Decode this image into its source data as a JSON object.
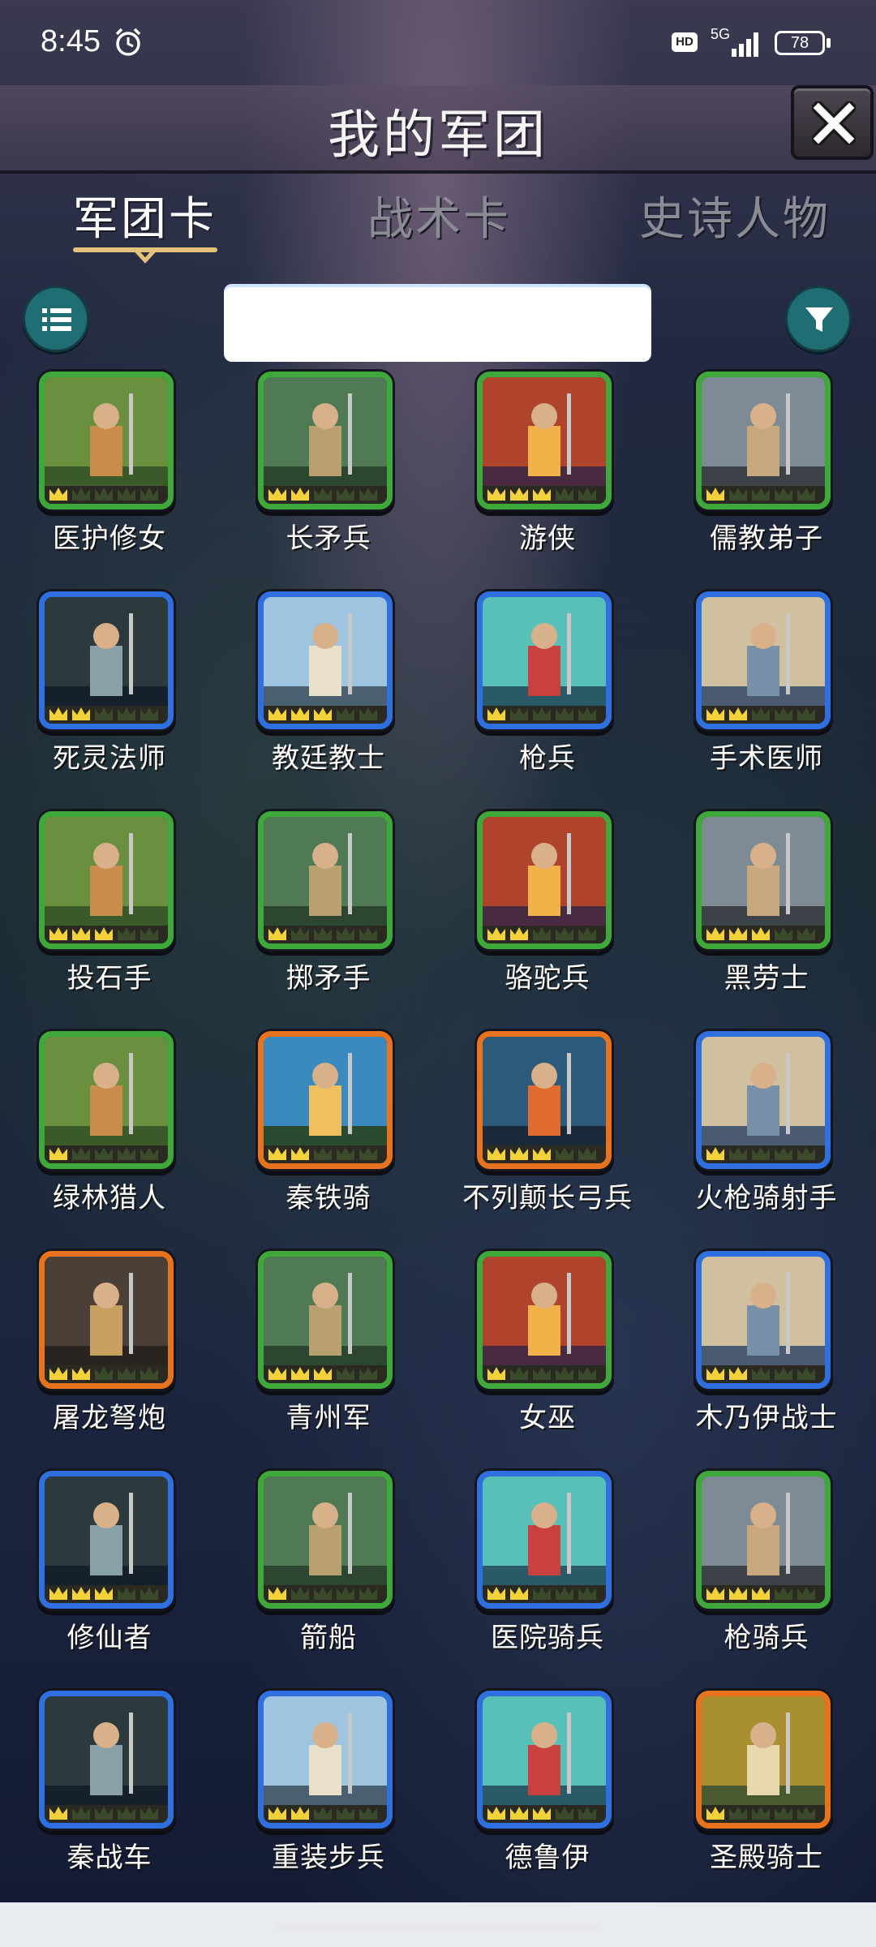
{
  "status_bar": {
    "time": "8:45",
    "hd": "HD",
    "network": "5G",
    "battery": "78",
    "icons": [
      "alarm-icon",
      "signal-icon",
      "battery-icon"
    ]
  },
  "header": {
    "title": "我的军团",
    "close_icon": "close-icon"
  },
  "tabs": [
    {
      "label": "军团卡",
      "active": true
    },
    {
      "label": "战术卡",
      "active": false
    },
    {
      "label": "史诗人物",
      "active": false
    }
  ],
  "toolbar": {
    "list_icon": "list-icon",
    "filter_icon": "filter-icon",
    "search_value": "",
    "search_placeholder": ""
  },
  "colors": {
    "green": "#3fa83a",
    "blue": "#2f6fe0",
    "orange": "#e8731e"
  },
  "cards": [
    {
      "name": "医护修女",
      "rarity": "green"
    },
    {
      "name": "长矛兵",
      "rarity": "green"
    },
    {
      "name": "游侠",
      "rarity": "green"
    },
    {
      "name": "儒教弟子",
      "rarity": "green"
    },
    {
      "name": "死灵法师",
      "rarity": "blue"
    },
    {
      "name": "教廷教士",
      "rarity": "blue"
    },
    {
      "name": "枪兵",
      "rarity": "blue"
    },
    {
      "name": "手术医师",
      "rarity": "blue"
    },
    {
      "name": "投石手",
      "rarity": "green"
    },
    {
      "name": "掷矛手",
      "rarity": "green"
    },
    {
      "name": "骆驼兵",
      "rarity": "green"
    },
    {
      "name": "黑劳士",
      "rarity": "green"
    },
    {
      "name": "绿林猎人",
      "rarity": "green"
    },
    {
      "name": "秦铁骑",
      "rarity": "orange"
    },
    {
      "name": "不列颠长弓兵",
      "rarity": "orange"
    },
    {
      "name": "火枪骑射手",
      "rarity": "blue"
    },
    {
      "name": "屠龙弩炮",
      "rarity": "orange"
    },
    {
      "name": "青州军",
      "rarity": "green"
    },
    {
      "name": "女巫",
      "rarity": "green"
    },
    {
      "name": "木乃伊战士",
      "rarity": "blue"
    },
    {
      "name": "修仙者",
      "rarity": "blue"
    },
    {
      "name": "箭船",
      "rarity": "green"
    },
    {
      "name": "医院骑兵",
      "rarity": "blue"
    },
    {
      "name": "枪骑兵",
      "rarity": "green"
    },
    {
      "name": "秦战车",
      "rarity": "blue"
    },
    {
      "name": "重装步兵",
      "rarity": "blue"
    },
    {
      "name": "德鲁伊",
      "rarity": "blue"
    },
    {
      "name": "圣殿骑士",
      "rarity": "orange"
    }
  ]
}
